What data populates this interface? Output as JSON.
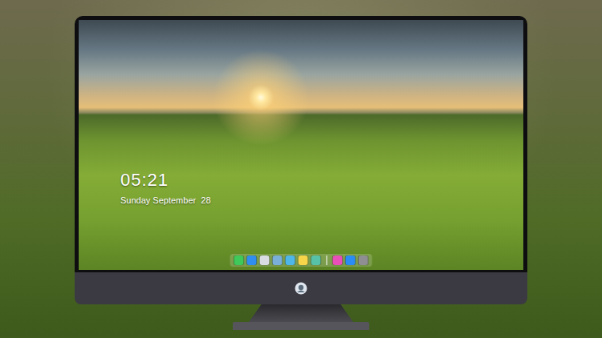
{
  "screen": {
    "clock": {
      "time": "05:21",
      "date": "Sunday September  28"
    }
  },
  "dock": {
    "items": [
      {
        "kind": "app",
        "color": "#3ec95a"
      },
      {
        "kind": "app",
        "color": "#2f8ef0"
      },
      {
        "kind": "app",
        "color": "#d9dde3"
      },
      {
        "kind": "app",
        "color": "#7ab0d8"
      },
      {
        "kind": "app",
        "color": "#4fb6e8"
      },
      {
        "kind": "app",
        "color": "#f6d54a"
      },
      {
        "kind": "app",
        "color": "#58c2a8"
      },
      {
        "kind": "separator",
        "color": "#ffffff"
      },
      {
        "kind": "app",
        "color": "#e84fb8"
      },
      {
        "kind": "app",
        "color": "#2a8df5"
      },
      {
        "kind": "app",
        "color": "#8e8e93"
      }
    ]
  }
}
